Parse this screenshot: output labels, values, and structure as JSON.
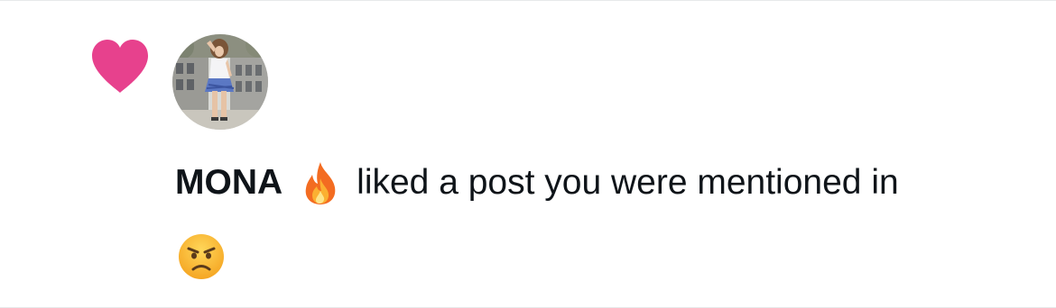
{
  "notification": {
    "actor_name": "MONA",
    "action_text": "liked a post you were mentioned in",
    "type_icon": "heart-icon",
    "name_emoji": "fire-icon",
    "post_emoji": "angry-face-icon",
    "avatar_alt": "MONA profile photo"
  },
  "colors": {
    "heart": "#e7418d",
    "text": "#0f1419",
    "divider": "#e7e9ea",
    "background": "#ffffff"
  }
}
